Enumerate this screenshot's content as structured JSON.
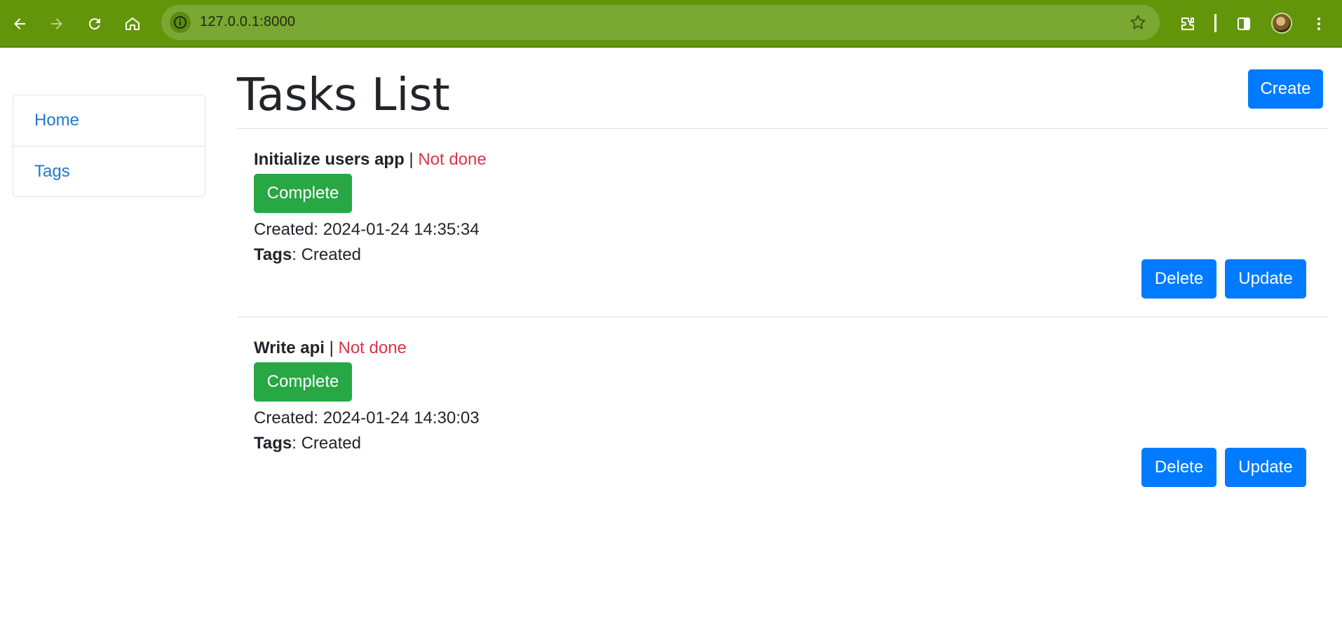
{
  "browser": {
    "url": "127.0.0.1:8000",
    "icons": [
      "back-arrow-icon",
      "forward-arrow-icon",
      "reload-icon",
      "home-icon",
      "site-info-icon",
      "bookmark-star-icon",
      "extensions-icon",
      "side-panel-icon",
      "profile-avatar",
      "kebab-menu-icon"
    ],
    "colors": {
      "toolbar": "#63950a",
      "omnibox": "#7aa832"
    }
  },
  "sidebar": {
    "items": [
      {
        "label": "Home"
      },
      {
        "label": "Tags"
      }
    ]
  },
  "header": {
    "title": "Tasks List",
    "create_label": "Create"
  },
  "tasks": [
    {
      "name": "Initialize users app",
      "separator": "|",
      "status": "Not done",
      "complete_label": "Complete",
      "created": "Created: 2024-01-24 14:35:34",
      "tags_label": "Tags",
      "tags_value": ": Created",
      "delete_label": "Delete",
      "update_label": "Update"
    },
    {
      "name": "Write api",
      "separator": "|",
      "status": "Not done",
      "complete_label": "Complete",
      "created": "Created: 2024-01-24 14:30:03",
      "tags_label": "Tags",
      "tags_value": ": Created",
      "delete_label": "Delete",
      "update_label": "Update"
    }
  ],
  "colors": {
    "primary": "#007bff",
    "success": "#28a745",
    "danger": "#dc3545",
    "link": "#1f78d1"
  }
}
